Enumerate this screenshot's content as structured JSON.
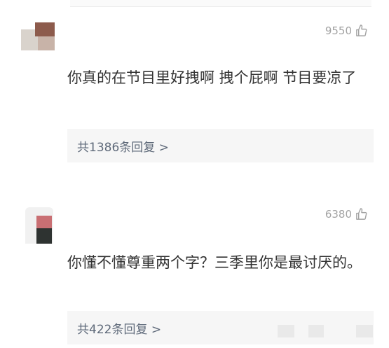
{
  "comments": [
    {
      "likes": "9550",
      "text": "你真的在节目里好拽啊 拽个屁啊 节目要凉了",
      "reply_summary": "共1386条回复 >"
    },
    {
      "likes": "6380",
      "text": "你懂不懂尊重两个字？三季里你是最讨厌的。",
      "reply_summary": "共422条回复 >"
    }
  ],
  "icons": {
    "like": "thumbs-up-icon",
    "avatar": "avatar"
  }
}
